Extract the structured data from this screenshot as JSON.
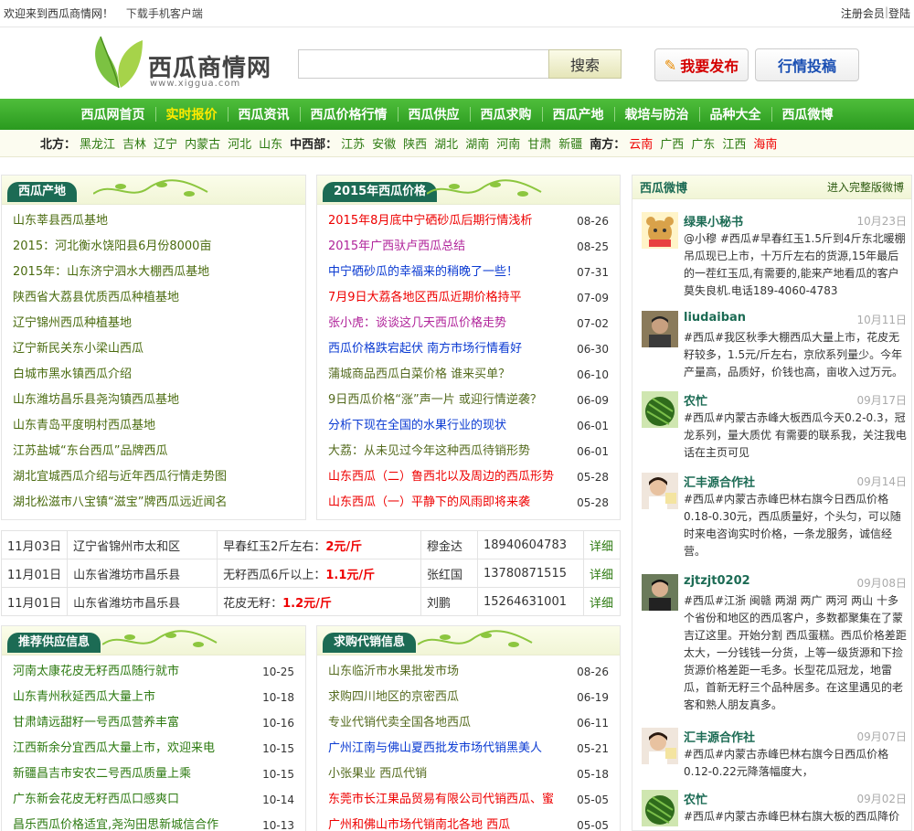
{
  "topbar": {
    "welcome": "欢迎来到西瓜商情网！",
    "download": "下载手机客户端",
    "register": "注册会员",
    "sep": "|",
    "login": "登陆"
  },
  "logo": {
    "cn": "西瓜商情网",
    "en": "www.xiggua.com"
  },
  "search": {
    "value": "",
    "button": "搜索"
  },
  "actions": {
    "publish": "我要发布",
    "submit": "行情投稿"
  },
  "nav": {
    "items": [
      "西瓜网首页",
      "实时报价",
      "西瓜资讯",
      "西瓜价格行情",
      "西瓜供应",
      "西瓜求购",
      "西瓜产地",
      "栽培与防治",
      "品种大全",
      "西瓜微博"
    ]
  },
  "regions": {
    "north_label": "北方：",
    "north": [
      "黑龙江",
      "吉林",
      "辽宁",
      "内蒙古",
      "河北",
      "山东"
    ],
    "central_label": "中西部：",
    "central": [
      "江苏",
      "安徽",
      "陕西",
      "湖北",
      "湖南",
      "河南",
      "甘肃",
      "新疆"
    ],
    "south_label": "南方：",
    "south": [
      "云南",
      "广西",
      "广东",
      "江西",
      "海南"
    ]
  },
  "origin": {
    "title": "西瓜产地",
    "items": [
      "山东莘县西瓜基地",
      "2015：河北衡水饶阳县6月份8000亩",
      "2015年：山东济宁泗水大棚西瓜基地",
      "陕西省大荔县优质西瓜种植基地",
      "辽宁锦州西瓜种植基地",
      "辽宁新民关东小梁山西瓜",
      "白城市黑水镇西瓜介绍",
      "山东潍坊昌乐县尧沟镇西瓜基地",
      "山东青岛平度明村西瓜基地",
      "江苏盐城“东台西瓜”品牌西瓜",
      "湖北宜城西瓜介绍与近年西瓜行情走势图",
      "湖北松滋市八宝镇“滋宝”牌西瓜远近闻名"
    ]
  },
  "prices2015": {
    "title": "2015年西瓜价格",
    "items": [
      {
        "t": "2015年8月底中宁硒砂瓜后期行情浅析",
        "d": "08-26",
        "c": "c-red"
      },
      {
        "t": "2015年广西驮卢西瓜总结",
        "d": "08-25",
        "c": "c-purple"
      },
      {
        "t": "中宁硒砂瓜的幸福来的稍晚了一些！",
        "d": "07-31",
        "c": "c-blue"
      },
      {
        "t": "7月9日大荔各地区西瓜近期价格持平",
        "d": "07-09",
        "c": "c-red"
      },
      {
        "t": "张小虎：谈谈这几天西瓜价格走势",
        "d": "07-02",
        "c": "c-purple"
      },
      {
        "t": "西瓜价格跌宕起伏 南方市场行情看好",
        "d": "06-30",
        "c": "c-blue"
      },
      {
        "t": "蒲城商品西瓜白菜价格 谁来买单？",
        "d": "06-10",
        "c": "c-dark"
      },
      {
        "t": "9日西瓜价格“涨”声一片 或迎行情逆袭？",
        "d": "06-09",
        "c": "c-dark"
      },
      {
        "t": "分析下现在全国的水果行业的现状",
        "d": "06-01",
        "c": "c-blue"
      },
      {
        "t": "大荔：从未见过今年这种西瓜待销形势",
        "d": "06-01",
        "c": "c-dark"
      },
      {
        "t": "山东西瓜（二）鲁西北以及周边的西瓜形势",
        "d": "05-28",
        "c": "c-red"
      },
      {
        "t": "山东西瓜（一）平静下的风雨即将来袭",
        "d": "05-28",
        "c": "c-red"
      }
    ]
  },
  "quotes": [
    {
      "date": "11月03日",
      "place": "辽宁省锦州市太和区",
      "desc": "早春红玉2斤左右：",
      "price": "2元/斤",
      "name": "穆金达",
      "phone": "18940604783",
      "more": "详细"
    },
    {
      "date": "11月01日",
      "place": "山东省潍坊市昌乐县",
      "desc": "无籽西瓜6斤以上：",
      "price": "1.1元/斤",
      "name": "张红国",
      "phone": "13780871515",
      "more": "详细"
    },
    {
      "date": "11月01日",
      "place": "山东省潍坊市昌乐县",
      "desc": "花皮无籽：",
      "price": "1.2元/斤",
      "name": "刘鹏",
      "phone": "15264631001",
      "more": "详细"
    }
  ],
  "supply": {
    "title": "推荐供应信息",
    "items": [
      {
        "t": "河南太康花皮无籽西瓜随行就市",
        "d": "10-25"
      },
      {
        "t": "山东青州秋延西瓜大量上市",
        "d": "10-18"
      },
      {
        "t": "甘肃靖远甜籽一号西瓜营养丰富",
        "d": "10-16"
      },
      {
        "t": "江西新余分宜西瓜大量上市，欢迎来电",
        "d": "10-15"
      },
      {
        "t": "新疆昌吉市安农二号西瓜质量上乘",
        "d": "10-15"
      },
      {
        "t": "广东新会花皮无籽西瓜口感爽口",
        "d": "10-14"
      },
      {
        "t": "昌乐西瓜价格适宜,尧沟田思新城信合作",
        "d": "10-13"
      }
    ]
  },
  "purchase": {
    "title": "求购代销信息",
    "items": [
      {
        "t": "山东临沂市水果批发市场",
        "d": "08-26",
        "c": "c-dark"
      },
      {
        "t": "求购四川地区的京密西瓜",
        "d": "06-19",
        "c": "c-dark"
      },
      {
        "t": "专业代销代卖全国各地西瓜",
        "d": "06-11",
        "c": "c-dark"
      },
      {
        "t": "广州江南与佛山夏西批发市场代销黑美人",
        "d": "05-21",
        "c": "c-blue"
      },
      {
        "t": "小张果业 西瓜代销",
        "d": "05-18",
        "c": "c-dark"
      },
      {
        "t": "东莞市长江果品贸易有限公司代销西瓜、蜜",
        "d": "05-05",
        "c": "c-red"
      },
      {
        "t": "广州和佛山市场代销南北各地 西瓜",
        "d": "05-05",
        "c": "c-red"
      }
    ]
  },
  "weibo": {
    "title": "西瓜微博",
    "more": "进入完整版微博",
    "posts": [
      {
        "user": "绿果小秘书",
        "time": "10月23日",
        "body": "@小穆 #西瓜#早春红玉1.5斤到4斤东北暖棚吊瓜现已上市，十万斤左右的货源,15年最后的一茬红玉瓜,有需要的,能来产地看瓜的客户莫失良机.电话189-4060-4783",
        "avatar": "bear"
      },
      {
        "user": "liudaiban",
        "time": "10月11日",
        "body": "#西瓜#我区秋季大棚西瓜大量上市，花皮无籽较多，1.5元/斤左右，京欣系列量少。今年产量高，品质好，价钱也高，亩收入过万元。",
        "avatar": "man"
      },
      {
        "user": "农忙",
        "time": "09月17日",
        "body": "#西瓜#内蒙古赤峰大板西瓜今天0.2-0.3，冠龙系列，量大质优 有需要的联系我，关注我电话在主页可见",
        "avatar": "melon"
      },
      {
        "user": "汇丰源合作社",
        "time": "09月14日",
        "body": "#西瓜#内蒙古赤峰巴林右旗今日西瓜价格0.18-0.30元，西瓜质量好，个头匀，可以随时来电咨询实时价格，一条龙服务，诚信经营。",
        "avatar": "woman"
      },
      {
        "user": "zjtzjt0202",
        "time": "09月08日",
        "body": "#西瓜#江浙 闽赣 两湖 两广 两河 两山 十多个省份和地区的西瓜客户，多数都聚集在了蒙吉辽这里。开始分割 西瓜蛋糕。西瓜价格差距太大，一分钱钱一分货，上等一级货源和下捡货源价格差距一毛多。长型花瓜冠龙，地雷瓜，首新无籽三个品种居多。在这里遇见的老客和熟人朋友真多。",
        "avatar": "man2"
      },
      {
        "user": "汇丰源合作社",
        "time": "09月07日",
        "body": "#西瓜#内蒙古赤峰巴林右旗今日西瓜价格0.12-0.22元降落幅度大，",
        "avatar": "woman"
      },
      {
        "user": "农忙",
        "time": "09月02日",
        "body": "#西瓜#内蒙古赤峰巴林右旗大板的西瓜降价",
        "avatar": "melon"
      }
    ]
  }
}
